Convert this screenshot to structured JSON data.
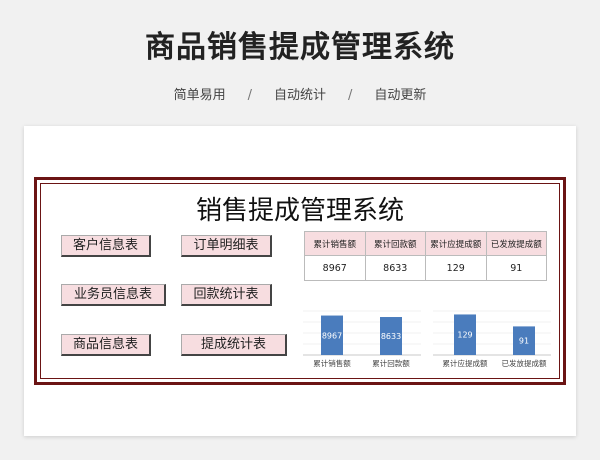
{
  "header": {
    "title": "商品销售提成管理系统",
    "tags": [
      "简单易用",
      "自动统计",
      "自动更新"
    ],
    "separator": "/"
  },
  "sheet": {
    "title": "销售提成管理系统",
    "buttons": [
      {
        "label": "客户信息表"
      },
      {
        "label": "订单明细表"
      },
      {
        "label": "业务员信息表"
      },
      {
        "label": "回款统计表"
      },
      {
        "label": "商品信息表"
      },
      {
        "label": "提成统计表"
      }
    ],
    "stats": {
      "headers": [
        "累计销售额",
        "累计回款额",
        "累计应提成额",
        "已发放提成额"
      ],
      "values": [
        "8967",
        "8633",
        "129",
        "91"
      ]
    }
  },
  "colors": {
    "frame": "#6b1414",
    "button_bg": "#f7dde0",
    "bar": "#4a7cbd"
  },
  "chart_data": [
    {
      "type": "bar",
      "categories": [
        "累计销售额",
        "累计回款额"
      ],
      "values": [
        8967,
        8633
      ],
      "ylim": [
        0,
        10000
      ],
      "grid": true
    },
    {
      "type": "bar",
      "categories": [
        "累计应提成额",
        "已发放提成额"
      ],
      "values": [
        129,
        91
      ],
      "ylim": [
        0,
        140
      ],
      "grid": true
    }
  ]
}
